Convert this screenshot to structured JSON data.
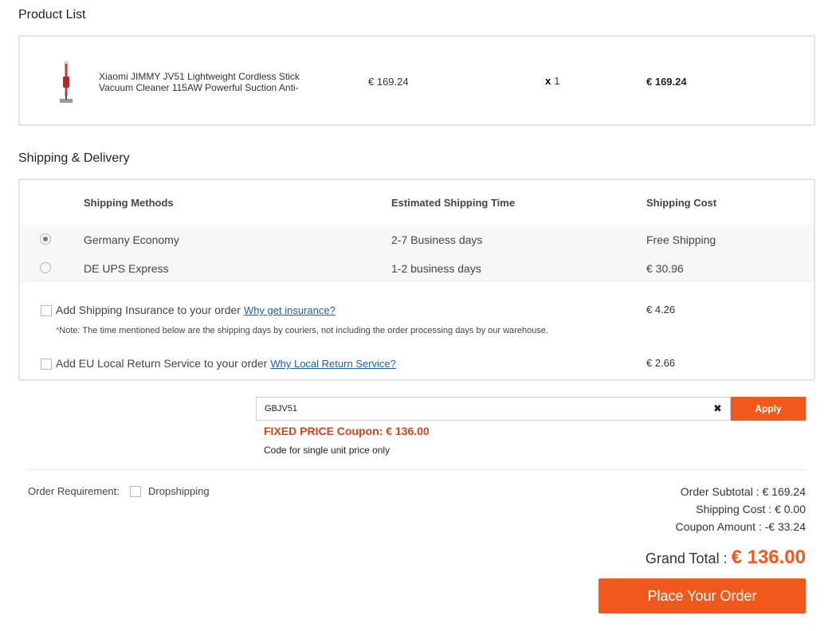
{
  "product_section": {
    "title": "Product List",
    "item": {
      "name": "Xiaomi JIMMY JV51 Lightweight Cordless Stick Vacuum Cleaner 115AW Powerful Suction Anti-",
      "price": "€ 169.24",
      "qty_prefix": "x",
      "qty": "1",
      "total": "€ 169.24",
      "image_icon": "vacuum-cleaner-icon"
    }
  },
  "shipping_section": {
    "title": "Shipping & Delivery",
    "headers": {
      "method": "Shipping Methods",
      "time": "Estimated Shipping Time",
      "cost": "Shipping Cost"
    },
    "methods": [
      {
        "name": "Germany Economy",
        "time": "2-7 Business days",
        "cost": "Free Shipping",
        "selected": true
      },
      {
        "name": "DE UPS Express",
        "time": "1-2 business days",
        "cost": "€ 30.96",
        "selected": false
      }
    ],
    "insurance": {
      "label": "Add Shipping Insurance to your order",
      "link": "Why get insurance?",
      "price": "€ 4.26",
      "checked": false
    },
    "note_star": "*",
    "note": "Note: The time mentioned below are the shipping days by couriers, not including the order processing days by our warehouse.",
    "return_service": {
      "label": "Add EU Local Return Service to your order",
      "link": "Why Local Return Service?",
      "price": "€ 2.66",
      "checked": false
    }
  },
  "coupon": {
    "value": "GBJV51",
    "clear_icon": "✖",
    "apply_label": "Apply",
    "message": "FIXED PRICE Coupon: € 136.00",
    "note": "Code for single unit price only"
  },
  "order_requirement": {
    "label": "Order Requirement:",
    "option": "Dropshipping",
    "checked": false
  },
  "summary": {
    "subtotal": "Order Subtotal : € 169.24",
    "shipping": "Shipping Cost : € 0.00",
    "coupon": "Coupon Amount : -€ 33.24",
    "grand_label": "Grand Total : ",
    "grand_value": "€ 136.00"
  },
  "place_order_label": "Place Your Order",
  "colors": {
    "accent": "#f0581c",
    "coupon_msg": "#d2431f",
    "link": "#1a5fa8",
    "border": "#e4e4e4"
  }
}
